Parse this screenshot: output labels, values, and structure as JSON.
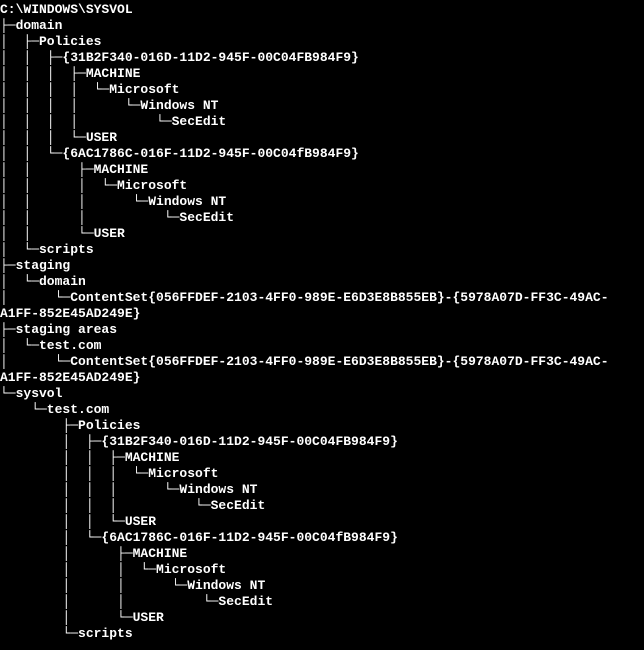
{
  "lines": [
    "C:\\WINDOWS\\SYSVOL",
    "├─domain",
    "│  ├─Policies",
    "│  │  ├─{31B2F340-016D-11D2-945F-00C04FB984F9}",
    "│  │  │  ├─MACHINE",
    "│  │  │  │  └─Microsoft",
    "│  │  │  │      └─Windows NT",
    "│  │  │  │          └─SecEdit",
    "│  │  │  └─USER",
    "│  │  └─{6AC1786C-016F-11D2-945F-00C04fB984F9}",
    "│  │      ├─MACHINE",
    "│  │      │  └─Microsoft",
    "│  │      │      └─Windows NT",
    "│  │      │          └─SecEdit",
    "│  │      └─USER",
    "│  └─scripts",
    "├─staging",
    "│  └─domain",
    "│      └─ContentSet{056FFDEF-2103-4FF0-989E-E6D3E8B855EB}-{5978A07D-FF3C-49AC-",
    "A1FF-852E45AD249E}",
    "├─staging areas",
    "│  └─test.com",
    "│      └─ContentSet{056FFDEF-2103-4FF0-989E-E6D3E8B855EB}-{5978A07D-FF3C-49AC-",
    "A1FF-852E45AD249E}",
    "└─sysvol",
    "    └─test.com",
    "        ├─Policies",
    "        │  ├─{31B2F340-016D-11D2-945F-00C04FB984F9}",
    "        │  │  ├─MACHINE",
    "        │  │  │  └─Microsoft",
    "        │  │  │      └─Windows NT",
    "        │  │  │          └─SecEdit",
    "        │  │  └─USER",
    "        │  └─{6AC1786C-016F-11D2-945F-00C04fB984F9}",
    "        │      ├─MACHINE",
    "        │      │  └─Microsoft",
    "        │      │      └─Windows NT",
    "        │      │          └─SecEdit",
    "        │      └─USER",
    "        └─scripts"
  ]
}
